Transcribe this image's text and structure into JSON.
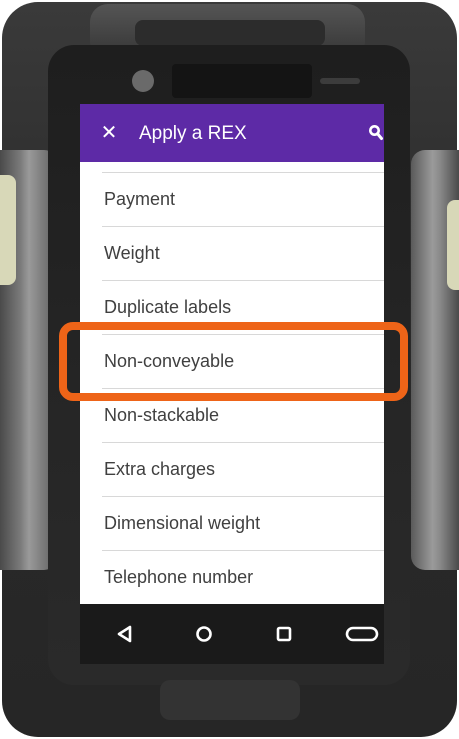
{
  "app_bar": {
    "close_label": "✕",
    "title": "Apply a REX",
    "search_icon": "search-icon",
    "background": "#5d2aa6"
  },
  "list": {
    "items": [
      {
        "label": "Payment"
      },
      {
        "label": "Weight"
      },
      {
        "label": "Duplicate labels"
      },
      {
        "label": "Non-conveyable",
        "highlighted": true
      },
      {
        "label": "Non-stackable"
      },
      {
        "label": "Extra charges"
      },
      {
        "label": "Dimensional weight"
      },
      {
        "label": "Telephone number"
      }
    ]
  },
  "nav_bar": {
    "buttons": [
      {
        "icon": "back-icon"
      },
      {
        "icon": "home-icon"
      },
      {
        "icon": "recent-apps-icon"
      },
      {
        "icon": "scan-trigger-icon"
      }
    ]
  },
  "highlight": {
    "color": "#ee6418"
  }
}
